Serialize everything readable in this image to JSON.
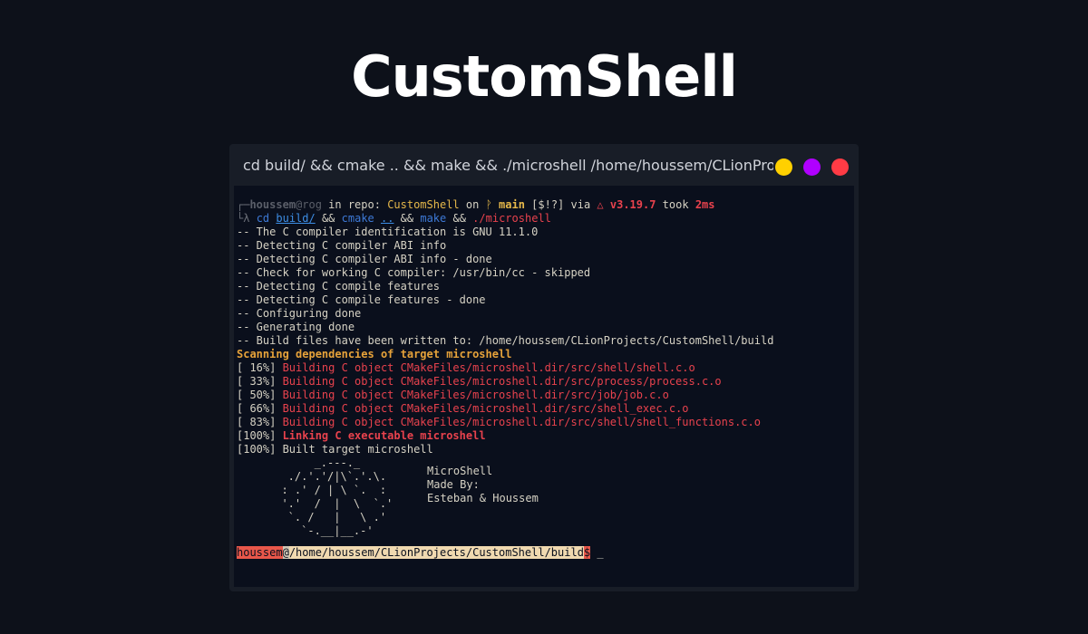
{
  "title": "CustomShell",
  "window": {
    "title_text": "cd build/ && cmake .. && make && ./microshell /home/houssem/CLionProject..."
  },
  "prompt": {
    "corner_top": "┌─",
    "user": "houssem",
    "at_host": "@rog",
    "in_repo": " in repo: ",
    "repo_name": "CustomShell",
    "on": " on ",
    "branch_icon": "ᚹ",
    "branch": "main",
    "status": " [$!?]",
    "via": " via ",
    "cmake_icon": "△",
    "cmake_version": "v3.19.7",
    "took": " took ",
    "duration": "2ms",
    "corner_bottom": "└λ ",
    "cmd_cd": "cd ",
    "cmd_build": "build/",
    "cmd_and1": " && ",
    "cmd_cmake": "cmake ",
    "cmd_dotdot": "..",
    "cmd_and2": " && ",
    "cmd_make": "make",
    "cmd_and3": " && ",
    "cmd_run": "./microshell"
  },
  "output_lines": [
    "-- The C compiler identification is GNU 11.1.0",
    "-- Detecting C compiler ABI info",
    "-- Detecting C compiler ABI info - done",
    "-- Check for working C compiler: /usr/bin/cc - skipped",
    "-- Detecting C compile features",
    "-- Detecting C compile features - done",
    "-- Configuring done",
    "-- Generating done",
    "-- Build files have been written to: /home/houssem/CLionProjects/CustomShell/build"
  ],
  "scanning": "Scanning dependencies of target microshell",
  "build_lines": [
    {
      "pct": "[ 16%] ",
      "text": "Building C object CMakeFiles/microshell.dir/src/shell/shell.c.o"
    },
    {
      "pct": "[ 33%] ",
      "text": "Building C object CMakeFiles/microshell.dir/src/process/process.c.o"
    },
    {
      "pct": "[ 50%] ",
      "text": "Building C object CMakeFiles/microshell.dir/src/job/job.c.o"
    },
    {
      "pct": "[ 66%] ",
      "text": "Building C object CMakeFiles/microshell.dir/src/shell_exec.c.o"
    },
    {
      "pct": "[ 83%] ",
      "text": "Building C object CMakeFiles/microshell.dir/src/shell/shell_functions.c.o"
    }
  ],
  "linking": {
    "pct": "[100%] ",
    "text": "Linking C executable microshell"
  },
  "built": "[100%] Built target microshell",
  "ascii_art": "       _.---._\n   ./.'.'/|\\`.'.\\.\n  : .' / | \\ `.  :\n  '.'  /  |  \\  `.'\n   `. /   |   \\ .'\n     `-.__|__.-'",
  "banner": {
    "line1": "MicroShell",
    "line2": "Made By:",
    "line3": "Esteban & Houssem"
  },
  "final_prompt": {
    "user": "houssem",
    "at": "@",
    "path": "/home/houssem/CLionProjects/CustomShell/build",
    "dollar": "$",
    "cursor": " _"
  }
}
